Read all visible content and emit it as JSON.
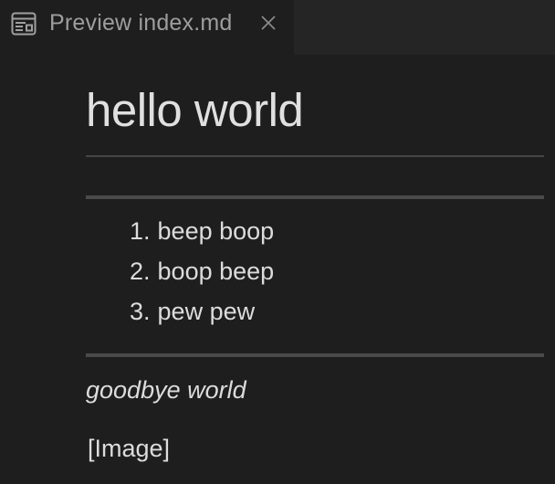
{
  "tabs": [
    {
      "label": "Preview index.md",
      "icon": "preview-icon",
      "close_icon": "close-icon",
      "active": true
    }
  ],
  "document": {
    "heading": "hello world",
    "list": [
      {
        "number": "1.",
        "text": "beep boop"
      },
      {
        "number": "2.",
        "text": "boop beep"
      },
      {
        "number": "3.",
        "text": "pew pew"
      }
    ],
    "emphasis": "goodbye world",
    "image_alt": "[Image]"
  },
  "colors": {
    "background": "#1e1e1e",
    "tabbar": "#252526",
    "text": "#dcdcdc",
    "tab_text": "#9d9d9d",
    "rule": "#4a4a4a"
  }
}
